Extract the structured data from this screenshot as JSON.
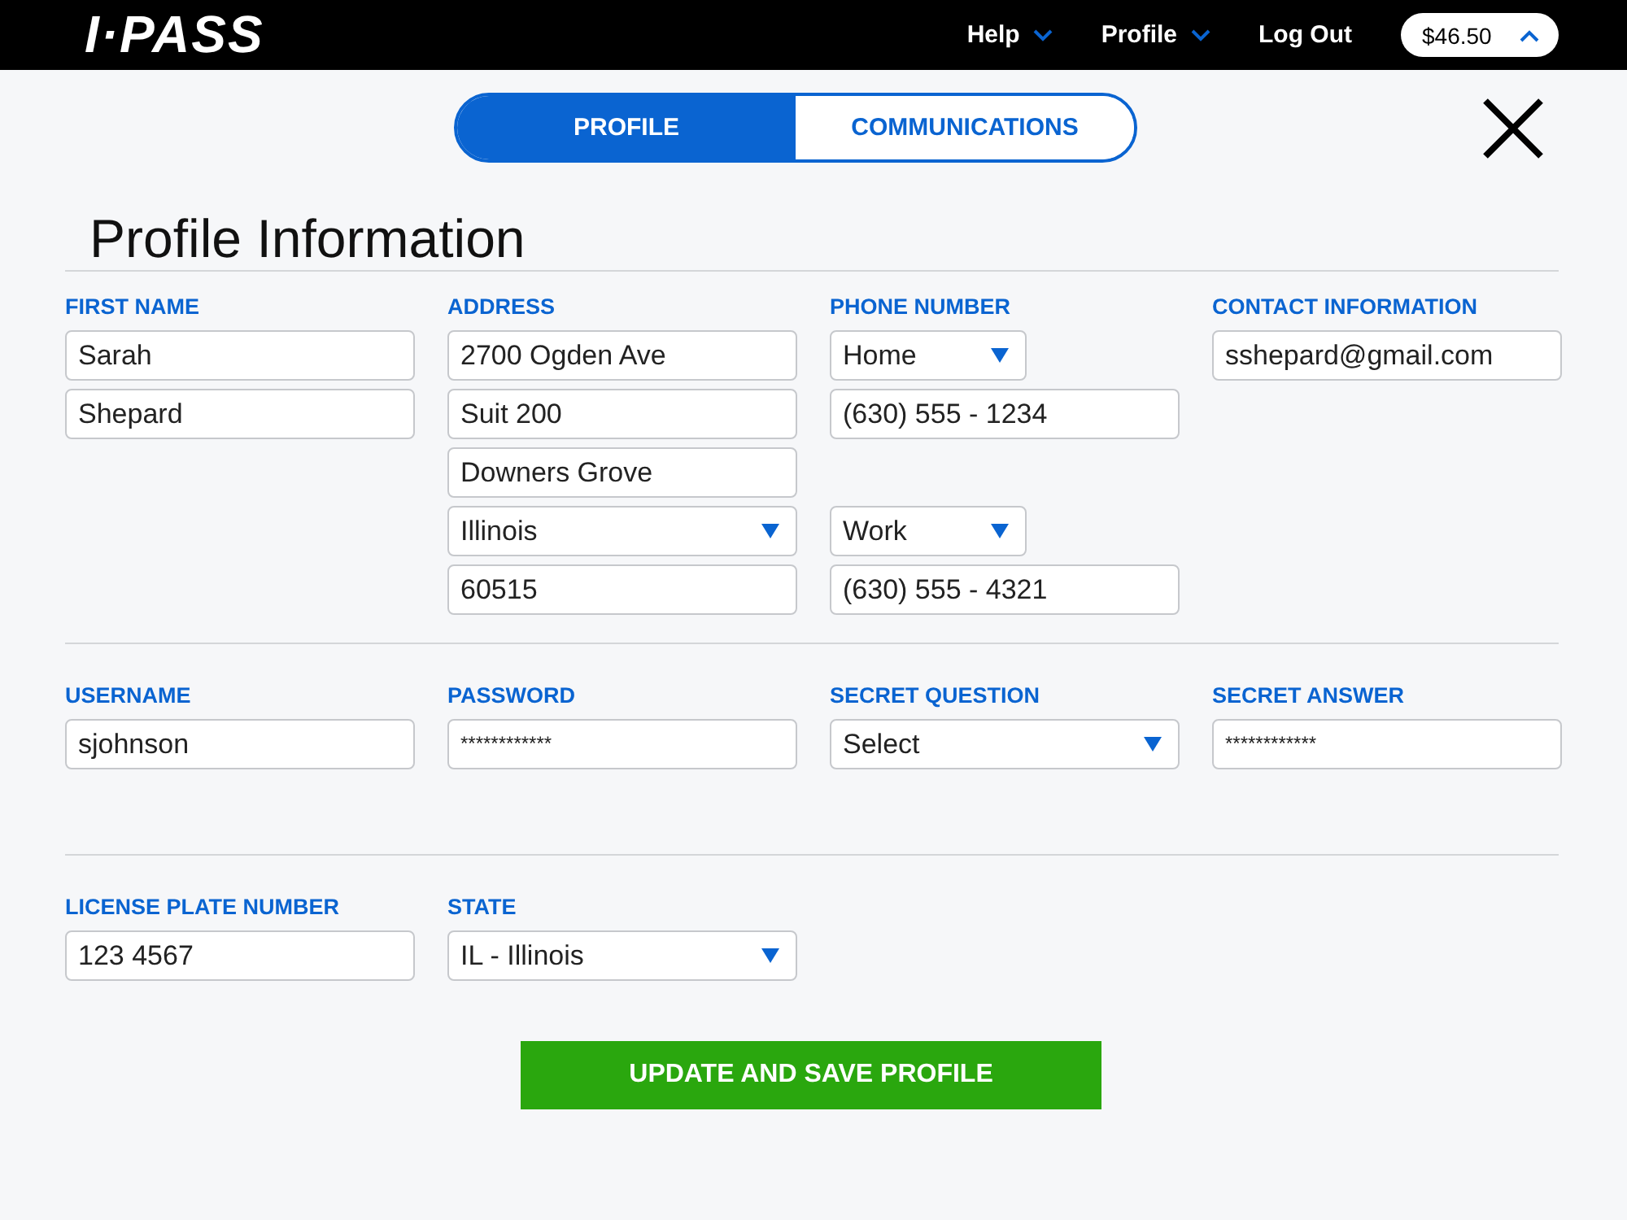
{
  "header": {
    "logo": "I·PASS",
    "nav": [
      {
        "label": "Help"
      },
      {
        "label": "Profile"
      },
      {
        "label": "Log Out",
        "kind": "link"
      }
    ],
    "balance": "$46.50"
  },
  "tabs": [
    {
      "label": "PROFILE",
      "selected": true
    },
    {
      "label": "COMMUNICATIONS",
      "selected": false
    }
  ],
  "title": "Profile Information",
  "sections": [
    {
      "columns": [
        {
          "label": "FIRST NAME",
          "groups": [
            [
              {
                "kind": "text",
                "value": "Sarah"
              },
              {
                "kind": "text",
                "value": "Shepard"
              }
            ]
          ]
        },
        {
          "label": "ADDRESS",
          "groups": [
            [
              {
                "kind": "text",
                "value": "2700 Ogden Ave"
              },
              {
                "kind": "text",
                "value": "Suit 200"
              },
              {
                "kind": "text",
                "value": "Downers Grove"
              },
              {
                "kind": "select",
                "value": "Illinois"
              },
              {
                "kind": "text",
                "value": "60515"
              }
            ]
          ]
        },
        {
          "label": "PHONE NUMBER",
          "groups": [
            [
              {
                "kind": "select",
                "value": "Home",
                "short": true
              },
              {
                "kind": "text",
                "value": "(630) 555 - 1234"
              }
            ],
            [
              {
                "kind": "select",
                "value": "Work",
                "short": true
              },
              {
                "kind": "text",
                "value": "(630) 555 - 4321"
              }
            ]
          ]
        },
        {
          "label": "CONTACT INFORMATION",
          "groups": [
            [
              {
                "kind": "text",
                "value": "sshepard@gmail.com"
              }
            ]
          ]
        }
      ]
    },
    {
      "columns": [
        {
          "label": "USERNAME",
          "groups": [
            [
              {
                "kind": "text",
                "value": "sjohnson"
              }
            ]
          ]
        },
        {
          "label": "PASSWORD",
          "groups": [
            [
              {
                "kind": "password",
                "value": "************"
              }
            ]
          ]
        },
        {
          "label": "SECRET QUESTION",
          "groups": [
            [
              {
                "kind": "select",
                "value": "Select"
              }
            ]
          ]
        },
        {
          "label": "SECRET ANSWER",
          "groups": [
            [
              {
                "kind": "password",
                "value": "************"
              }
            ]
          ]
        }
      ]
    },
    {
      "columns": [
        {
          "label": "LICENSE PLATE NUMBER",
          "groups": [
            [
              {
                "kind": "text",
                "value": "123 4567"
              }
            ]
          ]
        },
        {
          "label": "STATE",
          "groups": [
            [
              {
                "kind": "select",
                "value": "IL - Illinois"
              }
            ]
          ]
        }
      ]
    }
  ],
  "submit": "UPDATE AND SAVE PROFILE"
}
